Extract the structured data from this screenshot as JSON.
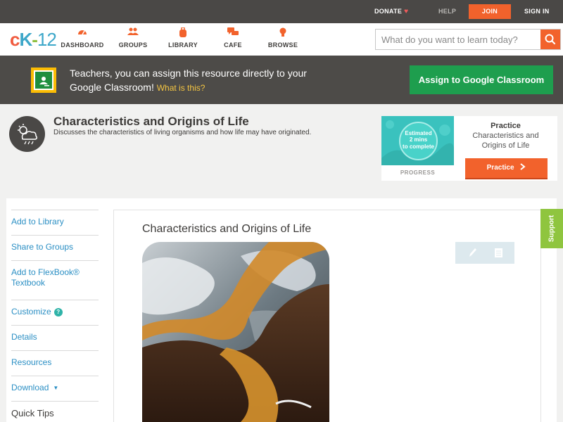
{
  "topbar": {
    "donate": "DONATE",
    "help": "HELP",
    "join": "JOIN",
    "signin": "SIGN IN"
  },
  "logo": {
    "c": "c",
    "k": "K",
    "dash": "-",
    "num": "12"
  },
  "nav": {
    "items": [
      {
        "label": "DASHBOARD",
        "icon": "dashboard-gauge-icon"
      },
      {
        "label": "GROUPS",
        "icon": "groups-people-icon"
      },
      {
        "label": "LIBRARY",
        "icon": "library-backpack-icon"
      },
      {
        "label": "CAFE",
        "icon": "cafe-chat-icon"
      },
      {
        "label": "BROWSE",
        "icon": "browse-lightbulb-icon"
      }
    ],
    "search_placeholder": "What do you want to learn today?"
  },
  "banner": {
    "text": "Teachers, you can assign this resource directly to your Google Classroom!",
    "what": "What is this?",
    "button": "Assign to Google Classroom"
  },
  "header": {
    "title": "Characteristics and Origins of Life",
    "description": "Discusses the characteristics of living organisms and how life may have originated."
  },
  "practice": {
    "estimated": "Estimated",
    "mins": "2 mins",
    "to_complete": "to complete",
    "progress_label": "PROGRESS",
    "heading": "Practice",
    "subtitle": "Characteristics and Origins of Life",
    "button": "Practice"
  },
  "sidebar": {
    "items": [
      "Add to Library",
      "Share to Groups",
      "Add to FlexBook® Textbook",
      "Customize",
      "Details",
      "Resources",
      "Download"
    ],
    "quick_tips": "Quick Tips"
  },
  "content": {
    "title": "Characteristics and Origins of Life"
  },
  "support": "Support",
  "colors": {
    "accent": "#f2622c",
    "link": "#2b8fc4",
    "topbar": "#4a4846",
    "banner": "#4d4b48",
    "assign": "#1e9e4e",
    "support": "#8fc53f",
    "teal": "#3ac2be"
  }
}
